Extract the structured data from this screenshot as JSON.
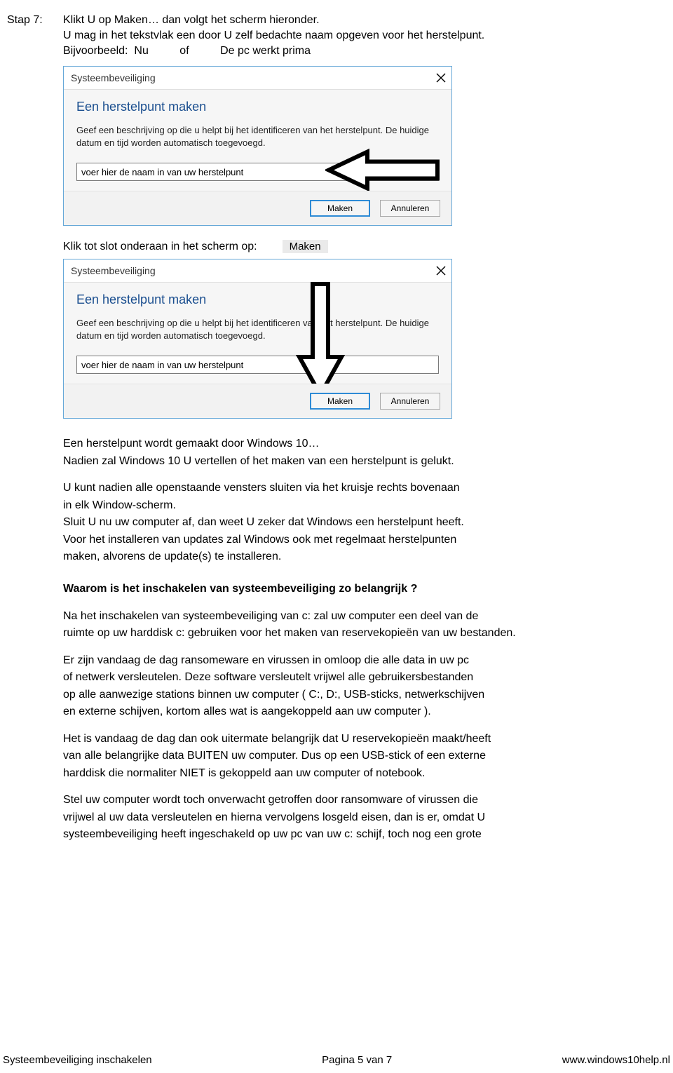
{
  "step": {
    "label": "Stap 7:",
    "line1": "Klikt U op Maken…  dan volgt het scherm hieronder.",
    "line2": "U mag in het tekstvlak een door U zelf bedachte naam opgeven voor het herstelpunt.",
    "line3": "Bijvoorbeeld:  Nu          of          De pc werkt prima"
  },
  "dialog1": {
    "title": "Systeembeveiliging",
    "heading": "Een herstelpunt maken",
    "desc": "Geef een beschrijving op die u helpt bij het identificeren van het herstelpunt. De huidige datum en tijd worden automatisch toegevoegd.",
    "input_value": "voer hier de naam in van uw herstelpunt",
    "make": "Maken",
    "cancel": "Annuleren"
  },
  "mid": {
    "text": "Klik tot slot onderaan in het scherm op:",
    "chip": "Maken"
  },
  "dialog2": {
    "title": "Systeembeveiliging",
    "heading": "Een herstelpunt maken",
    "desc": "Geef een beschrijving op die u helpt bij het identificeren van het herstelpunt. De huidige datum en tijd worden automatisch toegevoegd.",
    "input_value": "voer hier de naam in van uw herstelpunt",
    "make": "Maken",
    "cancel": "Annuleren"
  },
  "after": {
    "l1": "Een herstelpunt wordt gemaakt door Windows 10…",
    "l2": "Nadien zal Windows 10 U vertellen of het maken van een herstelpunt is gelukt.",
    "l3": "U kunt nadien alle openstaande vensters sluiten via het kruisje rechts bovenaan",
    "l4": "in elk Window-scherm.",
    "l5": "Sluit U nu uw computer af, dan weet U zeker dat Windows een herstelpunt heeft.",
    "l6": "Voor het installeren van updates zal Windows ook met regelmaat herstelpunten",
    "l7": "maken, alvorens de update(s) te installeren."
  },
  "why": {
    "heading": "Waarom is het inschakelen van systeembeveiliging zo belangrijk ?",
    "p1a": "Na het inschakelen van systeembeveiliging van c: zal uw computer een deel van de",
    "p1b": "ruimte op uw harddisk c: gebruiken voor het maken van reservekopieën van uw bestanden.",
    "p2a": "Er zijn vandaag de dag ransomeware en virussen in omloop die alle data in uw pc",
    "p2b": "of netwerk versleutelen. Deze software versleutelt vrijwel alle gebruikersbestanden",
    "p2c": "op alle aanwezige stations binnen uw computer ( C:,  D:, USB-sticks, netwerkschijven",
    "p2d": "en externe schijven, kortom alles wat is aangekoppeld aan uw computer ).",
    "p3a": "Het is vandaag de dag dan ook uitermate belangrijk dat U reservekopieën maakt/heeft",
    "p3b": "van alle belangrijke data BUITEN uw computer. Dus op een USB-stick of een externe",
    "p3c": "harddisk die normaliter NIET is gekoppeld aan uw computer of notebook.",
    "p4a": "Stel uw computer wordt toch onverwacht getroffen door ransomware of virussen die",
    "p4b": "vrijwel al uw data versleutelen en hierna vervolgens losgeld eisen, dan is er, omdat U",
    "p4c": "systeembeveiliging heeft ingeschakeld op uw pc van uw c: schijf, toch nog een grote"
  },
  "footer": {
    "left": "Systeembeveiliging inschakelen",
    "center": "Pagina 5 van 7",
    "right": "www.windows10help.nl"
  }
}
